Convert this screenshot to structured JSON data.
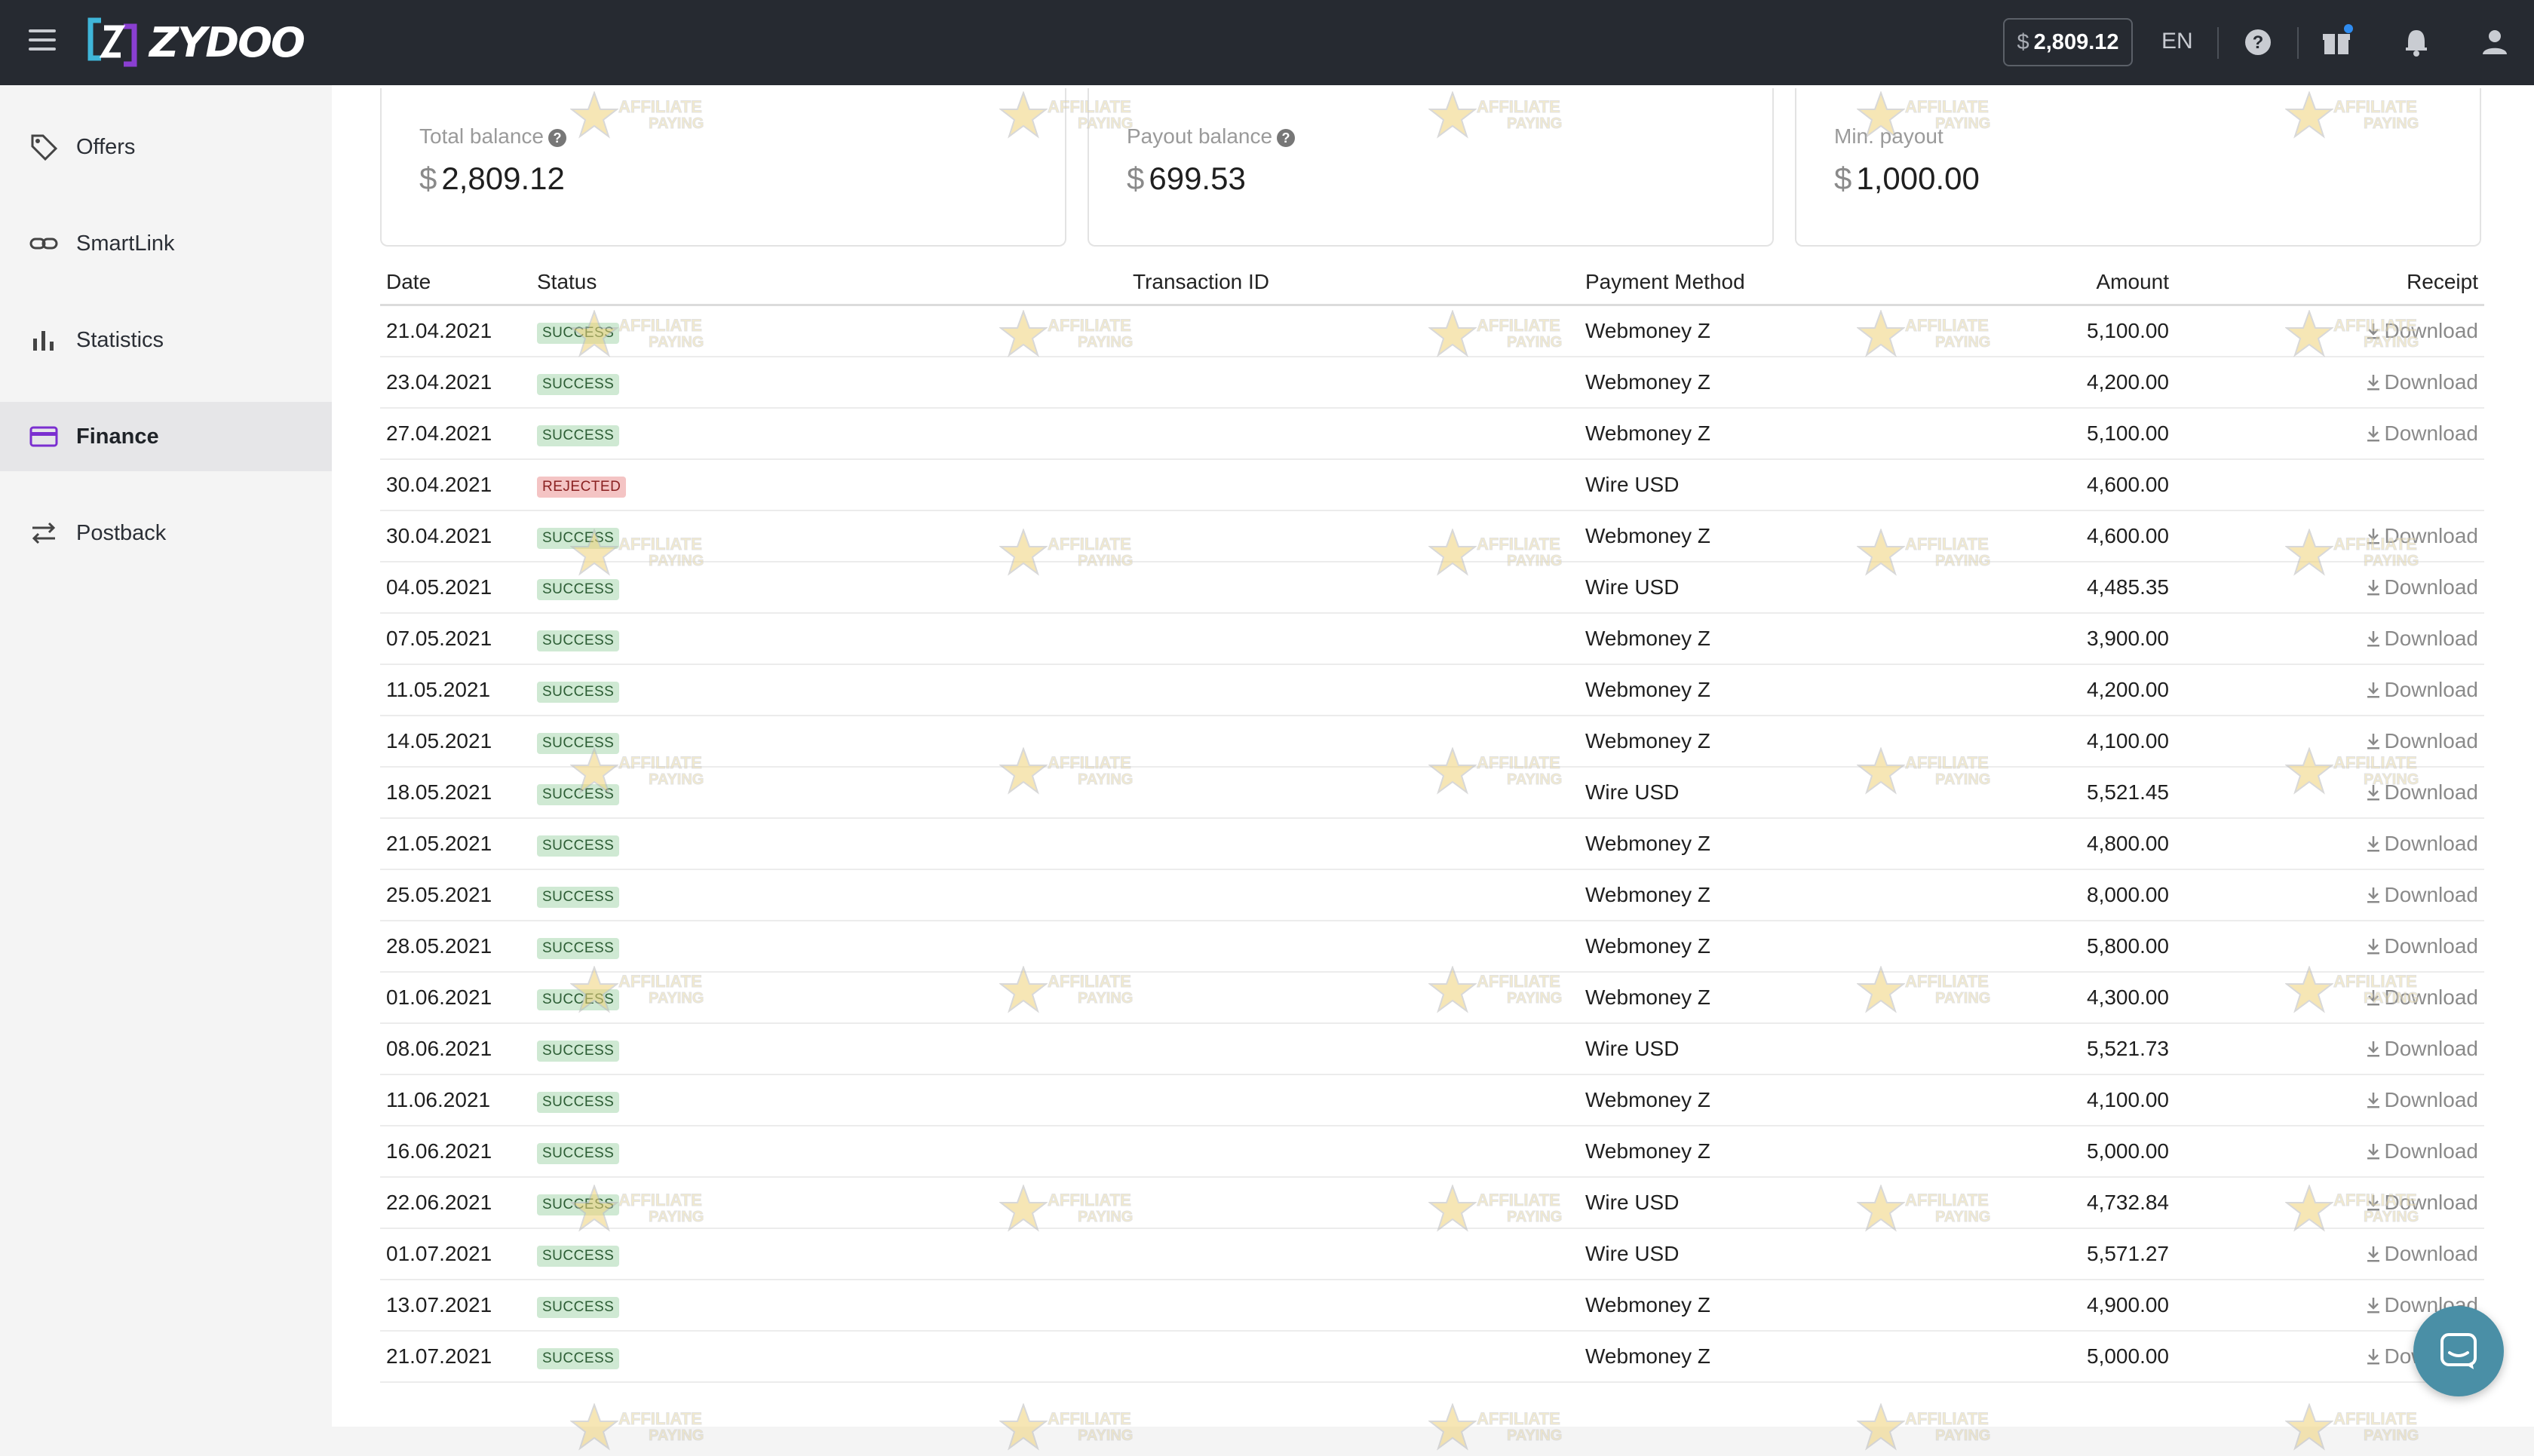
{
  "header": {
    "brand": "ZYDOO",
    "balance_currency": "$",
    "balance": "2,809.12",
    "language": "EN"
  },
  "sidebar": {
    "items": [
      {
        "label": "Offers",
        "icon": "tag-icon"
      },
      {
        "label": "SmartLink",
        "icon": "link-icon"
      },
      {
        "label": "Statistics",
        "icon": "bar-chart-icon"
      },
      {
        "label": "Finance",
        "icon": "credit-card-icon",
        "active": true
      },
      {
        "label": "Postback",
        "icon": "swap-arrows-icon"
      }
    ]
  },
  "summary": {
    "total_balance": {
      "label": "Total balance",
      "currency": "$",
      "value": "2,809.12"
    },
    "payout_balance": {
      "label": "Payout balance",
      "currency": "$",
      "value": "699.53"
    },
    "min_payout": {
      "label": "Min. payout",
      "currency": "$",
      "value": "1,000.00"
    }
  },
  "table": {
    "columns": [
      "Date",
      "Status",
      "Transaction ID",
      "Payment Method",
      "Amount",
      "Receipt"
    ],
    "rows": [
      {
        "date": "21.04.2021",
        "status": "SUCCESS",
        "txid": "",
        "method": "Webmoney Z",
        "amount": "5,100.00",
        "receipt": "Download"
      },
      {
        "date": "23.04.2021",
        "status": "SUCCESS",
        "txid": "",
        "method": "Webmoney Z",
        "amount": "4,200.00",
        "receipt": "Download"
      },
      {
        "date": "27.04.2021",
        "status": "SUCCESS",
        "txid": "",
        "method": "Webmoney Z",
        "amount": "5,100.00",
        "receipt": "Download"
      },
      {
        "date": "30.04.2021",
        "status": "REJECTED",
        "txid": "",
        "method": "Wire USD",
        "amount": "4,600.00",
        "receipt": ""
      },
      {
        "date": "30.04.2021",
        "status": "SUCCESS",
        "txid": "",
        "method": "Webmoney Z",
        "amount": "4,600.00",
        "receipt": "Download"
      },
      {
        "date": "04.05.2021",
        "status": "SUCCESS",
        "txid": "",
        "method": "Wire USD",
        "amount": "4,485.35",
        "receipt": "Download"
      },
      {
        "date": "07.05.2021",
        "status": "SUCCESS",
        "txid": "",
        "method": "Webmoney Z",
        "amount": "3,900.00",
        "receipt": "Download"
      },
      {
        "date": "11.05.2021",
        "status": "SUCCESS",
        "txid": "",
        "method": "Webmoney Z",
        "amount": "4,200.00",
        "receipt": "Download"
      },
      {
        "date": "14.05.2021",
        "status": "SUCCESS",
        "txid": "",
        "method": "Webmoney Z",
        "amount": "4,100.00",
        "receipt": "Download"
      },
      {
        "date": "18.05.2021",
        "status": "SUCCESS",
        "txid": "",
        "method": "Wire USD",
        "amount": "5,521.45",
        "receipt": "Download"
      },
      {
        "date": "21.05.2021",
        "status": "SUCCESS",
        "txid": "",
        "method": "Webmoney Z",
        "amount": "4,800.00",
        "receipt": "Download"
      },
      {
        "date": "25.05.2021",
        "status": "SUCCESS",
        "txid": "",
        "method": "Webmoney Z",
        "amount": "8,000.00",
        "receipt": "Download"
      },
      {
        "date": "28.05.2021",
        "status": "SUCCESS",
        "txid": "",
        "method": "Webmoney Z",
        "amount": "5,800.00",
        "receipt": "Download"
      },
      {
        "date": "01.06.2021",
        "status": "SUCCESS",
        "txid": "",
        "method": "Webmoney Z",
        "amount": "4,300.00",
        "receipt": "Download"
      },
      {
        "date": "08.06.2021",
        "status": "SUCCESS",
        "txid": "",
        "method": "Wire USD",
        "amount": "5,521.73",
        "receipt": "Download"
      },
      {
        "date": "11.06.2021",
        "status": "SUCCESS",
        "txid": "",
        "method": "Webmoney Z",
        "amount": "4,100.00",
        "receipt": "Download"
      },
      {
        "date": "16.06.2021",
        "status": "SUCCESS",
        "txid": "",
        "method": "Webmoney Z",
        "amount": "5,000.00",
        "receipt": "Download"
      },
      {
        "date": "22.06.2021",
        "status": "SUCCESS",
        "txid": "",
        "method": "Wire USD",
        "amount": "4,732.84",
        "receipt": "Download"
      },
      {
        "date": "01.07.2021",
        "status": "SUCCESS",
        "txid": "",
        "method": "Wire USD",
        "amount": "5,571.27",
        "receipt": "Download"
      },
      {
        "date": "13.07.2021",
        "status": "SUCCESS",
        "txid": "",
        "method": "Webmoney Z",
        "amount": "4,900.00",
        "receipt": "Download"
      },
      {
        "date": "21.07.2021",
        "status": "SUCCESS",
        "txid": "",
        "method": "Webmoney Z",
        "amount": "5,000.00",
        "receipt": "Download"
      }
    ]
  },
  "watermark": {
    "line1": "AFFILIATE",
    "line2": "PAYING"
  }
}
